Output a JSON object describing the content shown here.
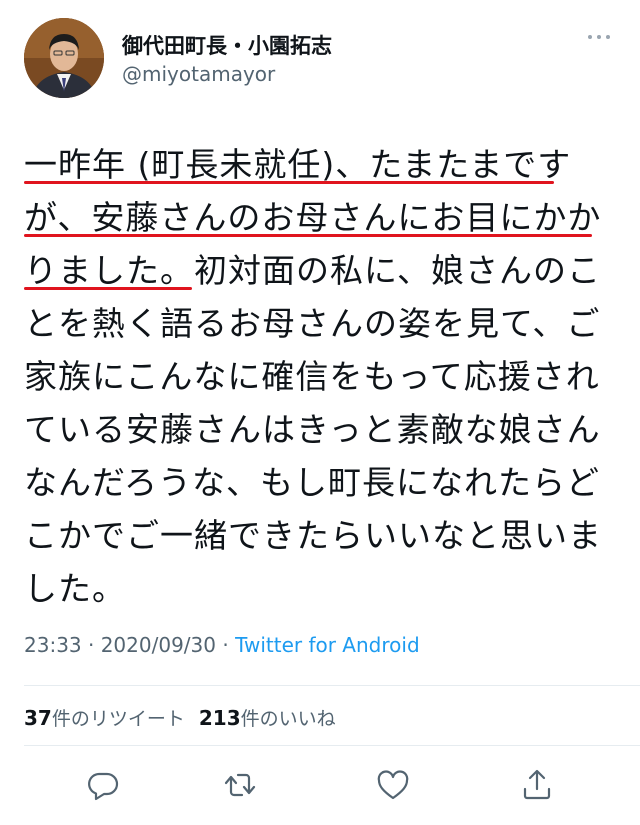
{
  "tweet": {
    "author_name": "御代田町長・小園拓志",
    "author_handle": "@miyotamayor",
    "lines": [
      "一昨年 (町長未就任)、たまたまです",
      "が、安藤さんのお母さんにお目にかか",
      "りました。初対面の私に、娘さんのこ",
      "とを熱く語るお母さんの姿を見て、ご",
      "家族にこんなに確信をもって応援され",
      "ている安藤さんはきっと素敵な娘さん",
      "なんだろうな、もし町長になれたらど",
      "こかでご一緒できたらいいなと思いま",
      "した。"
    ],
    "timestamp": "23:33 · 2020/09/30 · ",
    "source": "Twitter for Android",
    "retweet_count": "37",
    "retweet_label": "件のリツイート",
    "like_count": "213",
    "like_label": "件のいいね"
  },
  "icons": {
    "more": "more-horizontal-icon",
    "reply": "reply-icon",
    "retweet": "retweet-icon",
    "like": "heart-icon",
    "share": "share-icon"
  },
  "colors": {
    "highlight_underline": "#e0141e",
    "link": "#1d9bf0",
    "secondary_text": "#536471",
    "icon": "#536471"
  }
}
